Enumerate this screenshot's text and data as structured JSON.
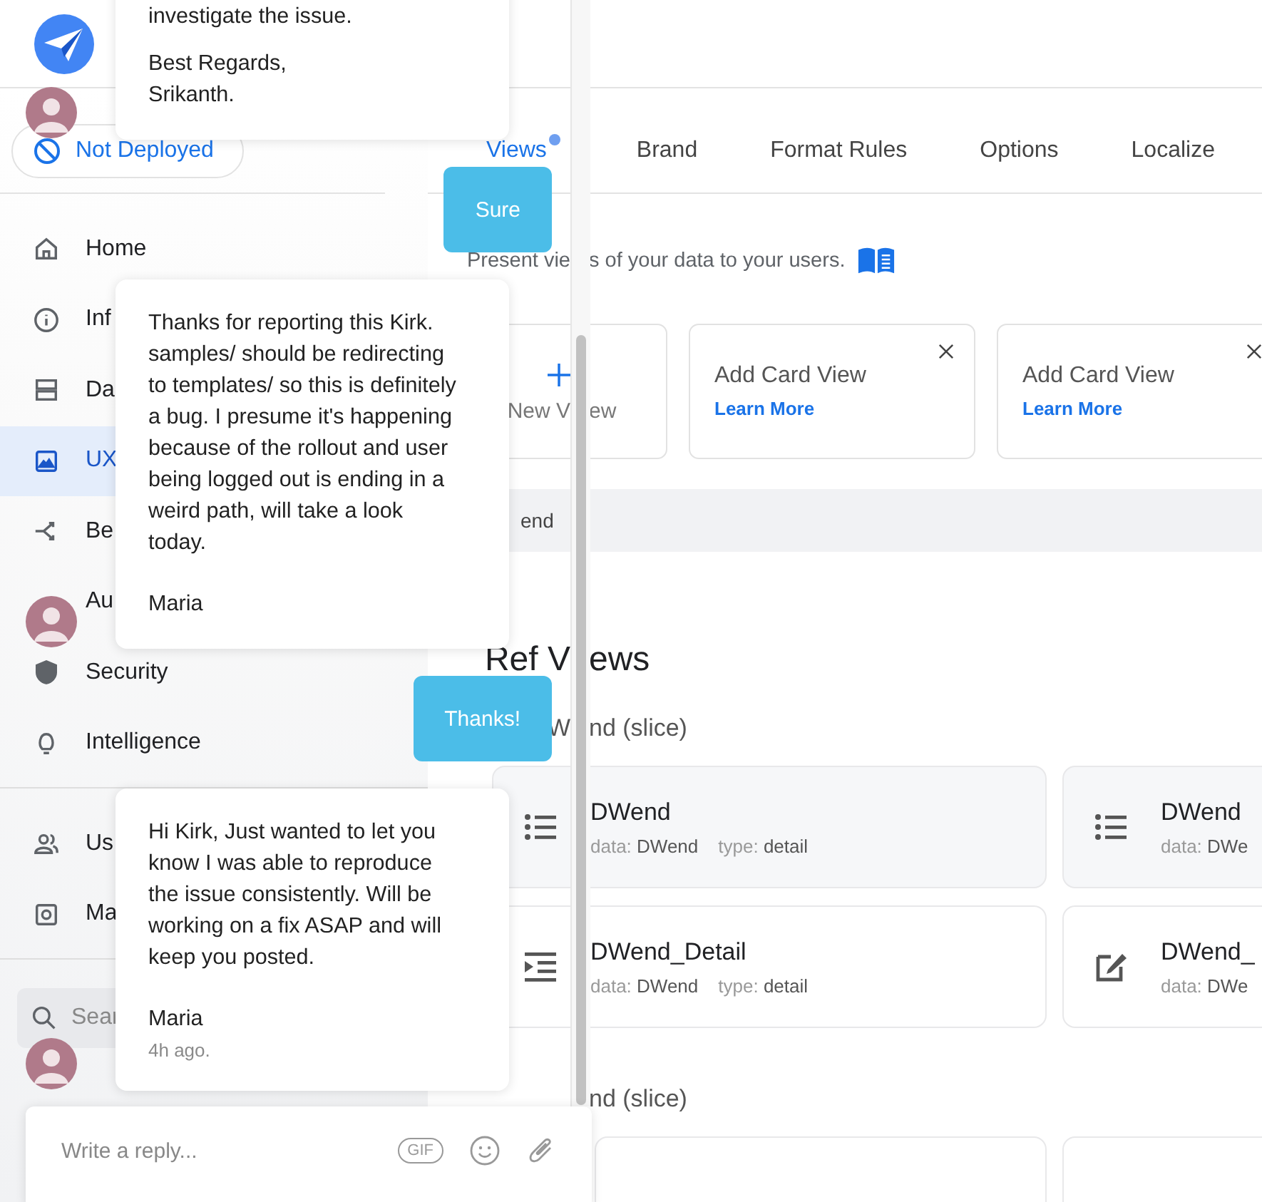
{
  "deploy_status": {
    "label": "Not Deployed"
  },
  "sidebar": {
    "sections": [
      [
        {
          "kind": "home",
          "label": "Home",
          "selected": false
        },
        {
          "kind": "info",
          "label": "Inf",
          "selected": false
        },
        {
          "kind": "data",
          "label": "Da",
          "selected": false
        },
        {
          "kind": "ux",
          "label": "UX",
          "selected": true
        },
        {
          "kind": "behavior",
          "label": "Be",
          "selected": false
        },
        {
          "kind": "automation",
          "label": "Au",
          "selected": false
        },
        {
          "kind": "security",
          "label": "Security",
          "selected": false
        },
        {
          "kind": "intelligence",
          "label": "Intelligence",
          "selected": false
        }
      ],
      [
        {
          "kind": "users",
          "label": "Us",
          "selected": false
        },
        {
          "kind": "manage",
          "label": "Ma",
          "selected": false
        }
      ]
    ],
    "search": {
      "placeholder": "Sear"
    }
  },
  "tabs": [
    {
      "label": "Views",
      "selected": true,
      "dot": true
    },
    {
      "label": "Brand",
      "selected": false,
      "dot": false
    },
    {
      "label": "Format Rules",
      "selected": false,
      "dot": false
    },
    {
      "label": "Options",
      "selected": false,
      "dot": false
    },
    {
      "label": "Localize",
      "selected": false,
      "dot": false
    }
  ],
  "views_panel": {
    "description": {
      "left_part": "Present vie",
      "right_part": "s of your data to your users."
    },
    "tiles": [
      {
        "kind": "new",
        "label": {
          "left_part": "New V",
          "right_part": "ew"
        }
      },
      {
        "kind": "promo",
        "title": "Add Card View",
        "link": "Learn More"
      },
      {
        "kind": "promo",
        "title": "Add Card View",
        "link": "Learn More"
      }
    ],
    "group_bar": {
      "label": "end"
    }
  },
  "ref_views": {
    "title": {
      "left_part": "Ref V",
      "right_part": "ews"
    },
    "groups": [
      {
        "title": {
          "left_part": "W",
          "right_part": "nd (slice)"
        },
        "cards": [
          {
            "kind": "list",
            "name": "DWend",
            "meta": [
              {
                "key": "data:",
                "value": "DWend"
              },
              {
                "key": "type:",
                "value": "detail"
              }
            ]
          },
          {
            "kind": "list",
            "name": "DWend",
            "meta": [
              {
                "key": "data:",
                "value": "DWe"
              }
            ]
          },
          {
            "kind": "detail",
            "name": "DWend_Detail",
            "meta": [
              {
                "key": "data:",
                "value": "DWend"
              },
              {
                "key": "type:",
                "value": "detail"
              }
            ]
          },
          {
            "kind": "form",
            "name": "DWend_",
            "meta": [
              {
                "key": "data:",
                "value": "DWe"
              }
            ]
          }
        ]
      },
      {
        "title": {
          "right_part": "nd (slice)"
        },
        "cards": [
          {
            "kind": "blank"
          },
          {
            "kind": "blank"
          }
        ]
      }
    ]
  },
  "chat": {
    "messages": [
      {
        "kind": "card",
        "paragraphs": [
          "investigate the issue.",
          "Best Regards,\nSrikanth."
        ]
      },
      {
        "kind": "bubble",
        "text": "Sure"
      },
      {
        "kind": "card",
        "paragraphs": [
          "Thanks for reporting this Kirk. samples/ should be redirecting to templates/ so this is definitely a bug. I presume it's happening because of the rollout and user being logged out is ending in a weird path, will take a look today."
        ],
        "signature": "Maria"
      },
      {
        "kind": "bubble",
        "text": "Thanks!"
      },
      {
        "kind": "card",
        "paragraphs": [
          "Hi Kirk, Just wanted to let you know I was able to reproduce the issue consistently. Will be working on a fix ASAP and will keep you posted."
        ],
        "signature": "Maria",
        "time": "4h ago."
      }
    ],
    "reply_box": {
      "placeholder": "Write a reply...",
      "gif_label": "GIF"
    }
  }
}
